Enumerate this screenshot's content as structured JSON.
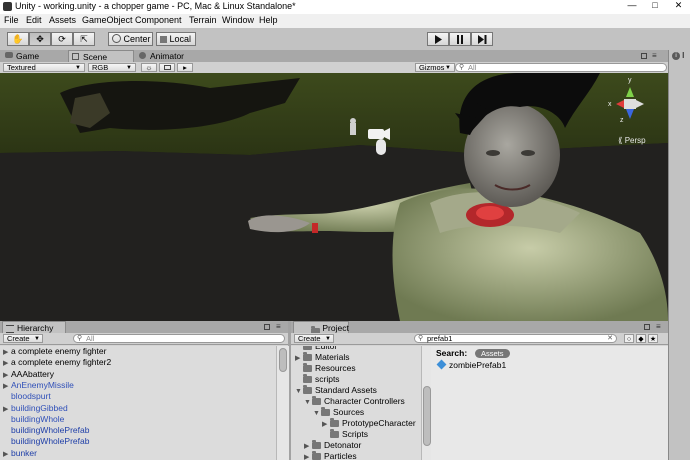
{
  "window": {
    "title": "Unity - working.unity - a chopper game - PC, Mac & Linux Standalone*"
  },
  "menu": [
    "File",
    "Edit",
    "Assets",
    "GameObject",
    "Component",
    "Terrain",
    "Window",
    "Help"
  ],
  "toolbar": {
    "pivot_label": "Center",
    "space_label": "Local"
  },
  "tabs": {
    "game": "Game",
    "scene": "Scene",
    "animator": "Animator"
  },
  "scene_toolbar": {
    "render_mode": "Textured",
    "color_mode": "RGB",
    "gizmos_label": "Gizmos",
    "search_placeholder": "All"
  },
  "scene": {
    "projection_label": "Persp",
    "gizmo_axes": {
      "y": "y",
      "x": "x",
      "z": "z"
    }
  },
  "hierarchy": {
    "tab": "Hierarchy",
    "create_label": "Create",
    "search_placeholder": "All",
    "items": [
      {
        "label": "a complete enemy fighter",
        "style": "normal",
        "expandable": true
      },
      {
        "label": "a complete enemy fighter2",
        "style": "normal",
        "expandable": true
      },
      {
        "label": "AAAbattery",
        "style": "normal",
        "expandable": true
      },
      {
        "label": "AnEnemyMissile",
        "style": "prefab",
        "expandable": true
      },
      {
        "label": "bloodspurt",
        "style": "prefab",
        "expandable": false
      },
      {
        "label": "buildingGibbed",
        "style": "prefab",
        "expandable": true
      },
      {
        "label": "buildingWhole",
        "style": "prefab",
        "expandable": false
      },
      {
        "label": "buildingWholePrefab",
        "style": "prefab-strong",
        "expandable": false
      },
      {
        "label": "buildingWholePrefab",
        "style": "prefab-strong",
        "expandable": false
      },
      {
        "label": "bunker",
        "style": "prefab-strong",
        "expandable": true
      }
    ]
  },
  "project": {
    "tab": "Project",
    "create_label": "Create",
    "search_value": "prefab1",
    "search_label": "Search:",
    "search_scope": "Assets",
    "tree": [
      {
        "label": "Editor",
        "indent": 1,
        "arrow": ""
      },
      {
        "label": "Materials",
        "indent": 1,
        "arrow": "right"
      },
      {
        "label": "Resources",
        "indent": 1,
        "arrow": ""
      },
      {
        "label": "scripts",
        "indent": 1,
        "arrow": ""
      },
      {
        "label": "Standard Assets",
        "indent": 1,
        "arrow": "down"
      },
      {
        "label": "Character Controllers",
        "indent": 2,
        "arrow": "down"
      },
      {
        "label": "Sources",
        "indent": 3,
        "arrow": "down"
      },
      {
        "label": "PrototypeCharacter",
        "indent": 4,
        "arrow": "right"
      },
      {
        "label": "Scripts",
        "indent": 4,
        "arrow": ""
      },
      {
        "label": "Detonator",
        "indent": 2,
        "arrow": "right"
      },
      {
        "label": "Particles",
        "indent": 2,
        "arrow": "right"
      }
    ],
    "results": [
      {
        "label": "zombiePrefab1",
        "icon": "prefab-cube-icon"
      }
    ]
  },
  "inspector": {
    "tab_initial": "I"
  }
}
